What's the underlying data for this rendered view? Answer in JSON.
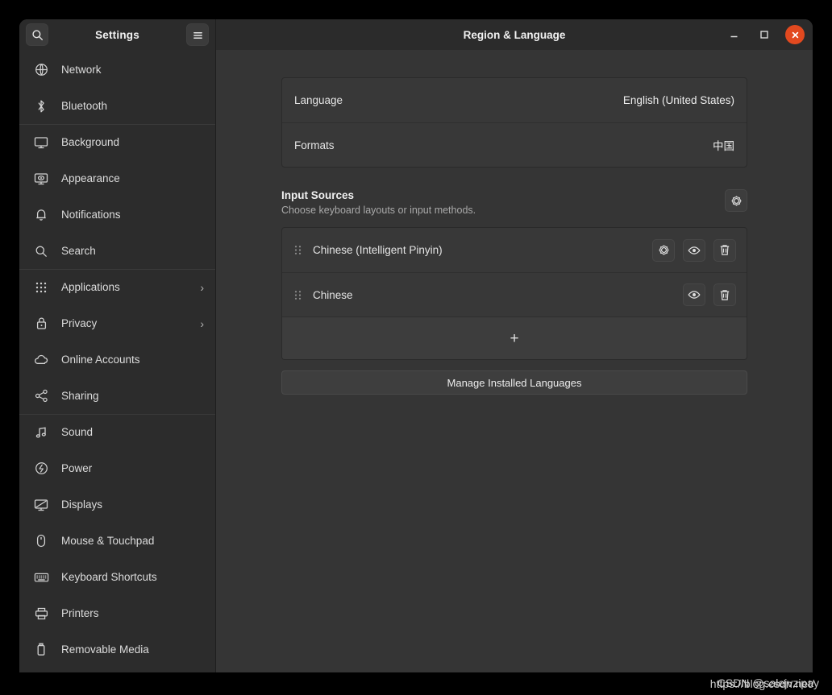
{
  "window": {
    "sidebar_title": "Settings",
    "content_title": "Region & Language",
    "search_icon": "search-icon",
    "menu_icon": "hamburger-menu-icon",
    "minimize_label": "–",
    "maximize_label": "▫",
    "close_label": "×",
    "close_color": "#e2491f"
  },
  "sidebar": {
    "items": [
      {
        "label": "Network",
        "icon": "globe-icon",
        "chevron": "",
        "separator": false
      },
      {
        "label": "Bluetooth",
        "icon": "bluetooth-icon",
        "chevron": "",
        "separator": false
      },
      {
        "label": "Background",
        "icon": "monitor-icon",
        "chevron": "",
        "separator": true
      },
      {
        "label": "Appearance",
        "icon": "monitor-eye-icon",
        "chevron": "",
        "separator": false
      },
      {
        "label": "Notifications",
        "icon": "bell-icon",
        "chevron": "",
        "separator": false
      },
      {
        "label": "Search",
        "icon": "search-icon",
        "chevron": "",
        "separator": false
      },
      {
        "label": "Applications",
        "icon": "grid-dots-icon",
        "chevron": "›",
        "separator": true
      },
      {
        "label": "Privacy",
        "icon": "lock-icon",
        "chevron": "›",
        "separator": false
      },
      {
        "label": "Online Accounts",
        "icon": "cloud-icon",
        "chevron": "",
        "separator": false
      },
      {
        "label": "Sharing",
        "icon": "share-nodes-icon",
        "chevron": "",
        "separator": false
      },
      {
        "label": "Sound",
        "icon": "music-note-icon",
        "chevron": "",
        "separator": true
      },
      {
        "label": "Power",
        "icon": "power-icon",
        "chevron": "",
        "separator": false
      },
      {
        "label": "Displays",
        "icon": "display-icon",
        "chevron": "",
        "separator": false
      },
      {
        "label": "Mouse & Touchpad",
        "icon": "mouse-icon",
        "chevron": "",
        "separator": false
      },
      {
        "label": "Keyboard Shortcuts",
        "icon": "keyboard-icon",
        "chevron": "",
        "separator": false
      },
      {
        "label": "Printers",
        "icon": "printer-icon",
        "chevron": "",
        "separator": false
      },
      {
        "label": "Removable Media",
        "icon": "usb-drive-icon",
        "chevron": "",
        "separator": false
      }
    ]
  },
  "main": {
    "language_row": {
      "label": "Language",
      "value": "English (United States)"
    },
    "formats_row": {
      "label": "Formats",
      "value": "中国"
    },
    "input_sources": {
      "title": "Input Sources",
      "subtitle": "Choose keyboard layouts or input methods.",
      "settings_icon": "gear-icon",
      "rows": [
        {
          "name": "Chinese (Intelligent Pinyin)",
          "handle_icon": "drag-handle-icon",
          "actions": [
            "gear-icon",
            "eye-icon",
            "trash-icon"
          ]
        },
        {
          "name": "Chinese",
          "handle_icon": "drag-handle-icon",
          "actions": [
            "eye-icon",
            "trash-icon"
          ]
        }
      ],
      "add_label": "+",
      "add_icon": "plus-icon"
    },
    "manage_button": "Manage Installed Languages"
  },
  "watermark": {
    "line1": "https://blog.csdn.net/",
    "line2": "CSDN @salejvzipay"
  }
}
